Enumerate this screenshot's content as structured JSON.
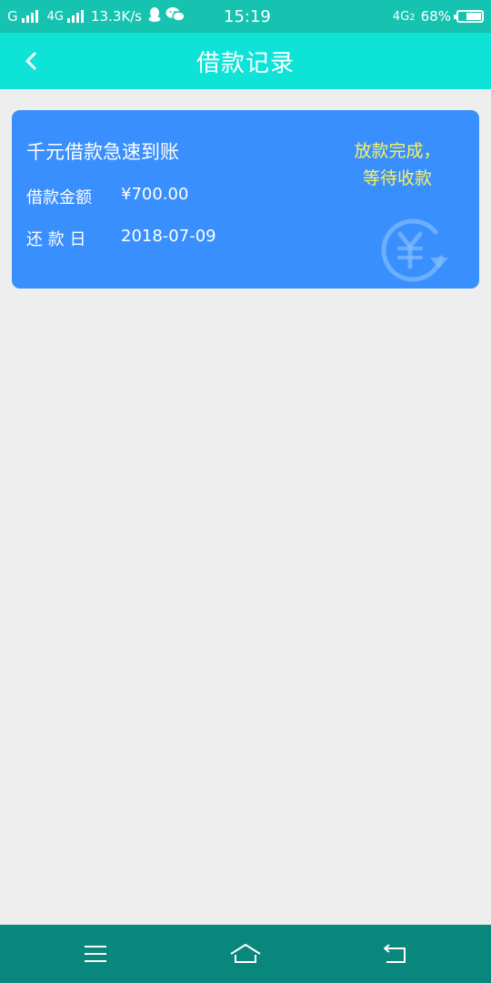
{
  "status_bar": {
    "carrier1": "G",
    "carrier2": "4G",
    "speed": "13.3K/s",
    "time": "15:19",
    "network_right": "4G",
    "network_sub": "2",
    "battery": "68%",
    "battery_level": 0.68,
    "icons": [
      "signal-icon",
      "qq-icon",
      "wechat-icon",
      "battery-icon"
    ]
  },
  "header": {
    "title": "借款记录",
    "back_icon": "chevron-left-icon",
    "background": "#0ee3d8"
  },
  "loan_record": {
    "title": "千元借款急速到账",
    "amount_label": "借款金额",
    "amount_value": "¥700.00",
    "due_label": "还 款 日",
    "due_value": "2018-07-09",
    "status_line1": "放款完成，",
    "status_line2": "等待收款",
    "watermark_icon": "yuan-refresh-icon",
    "card_color": "#3a8ffe",
    "status_color": "#fbf15c"
  },
  "nav_bar": {
    "menu_icon": "menu-icon",
    "home_icon": "home-icon",
    "back_icon": "back-arrow-icon",
    "background": "#0a877c"
  }
}
